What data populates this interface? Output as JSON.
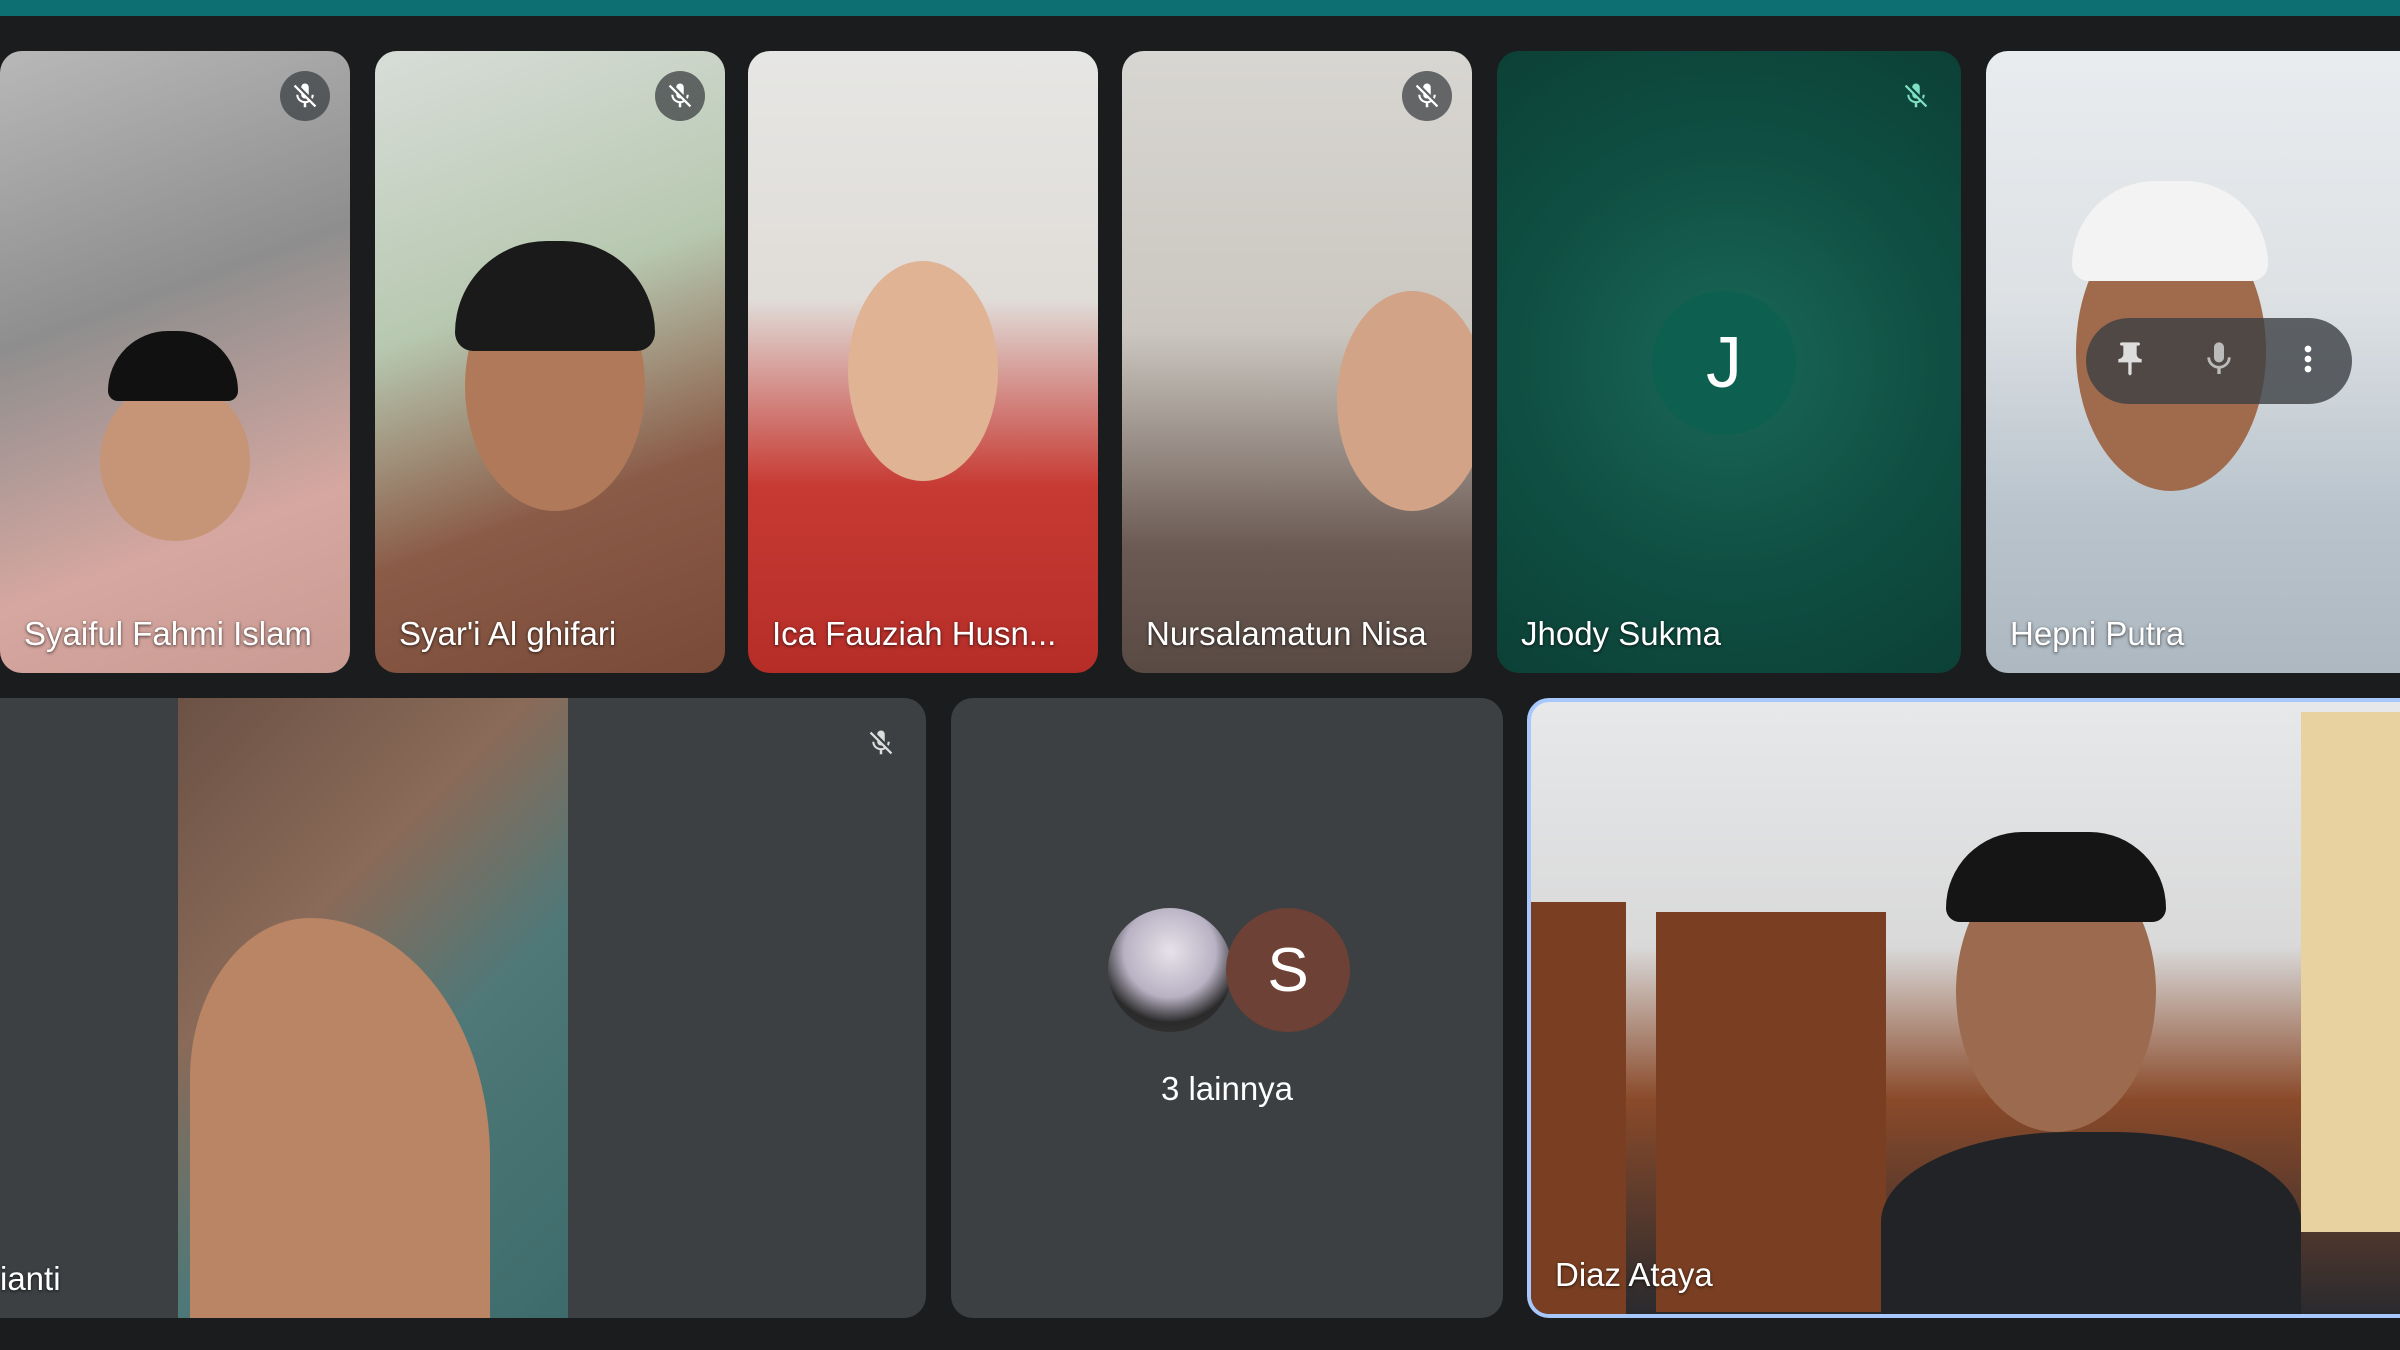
{
  "participants": [
    {
      "name": "Syaiful Fahmi Islam",
      "muted": true
    },
    {
      "name": "Syar'i Al ghifari",
      "muted": true
    },
    {
      "name": "Ica Fauziah Husn...",
      "muted": false
    },
    {
      "name": "Nursalamatun Nisa",
      "muted": true
    },
    {
      "name": "Jhody Sukma",
      "muted": true,
      "avatar_letter": "J"
    },
    {
      "name": "Hepni Putra",
      "muted": false
    },
    {
      "name": "ianti",
      "muted": true
    },
    {
      "name": "Diaz Ataya",
      "muted": false,
      "selected": true
    }
  ],
  "overflow": {
    "label": "3 lainnya",
    "avatar_letter": "S"
  },
  "hover_controls": {
    "icons": [
      "pin-icon",
      "mic-icon",
      "more-vert-icon"
    ]
  },
  "colors": {
    "top_bar": "#0e6f73",
    "tile_bg": "#3c4043",
    "avatar_J": "#0d5f4f",
    "avatar_S": "#6d4135",
    "selected_border": "#a8c7fa"
  }
}
